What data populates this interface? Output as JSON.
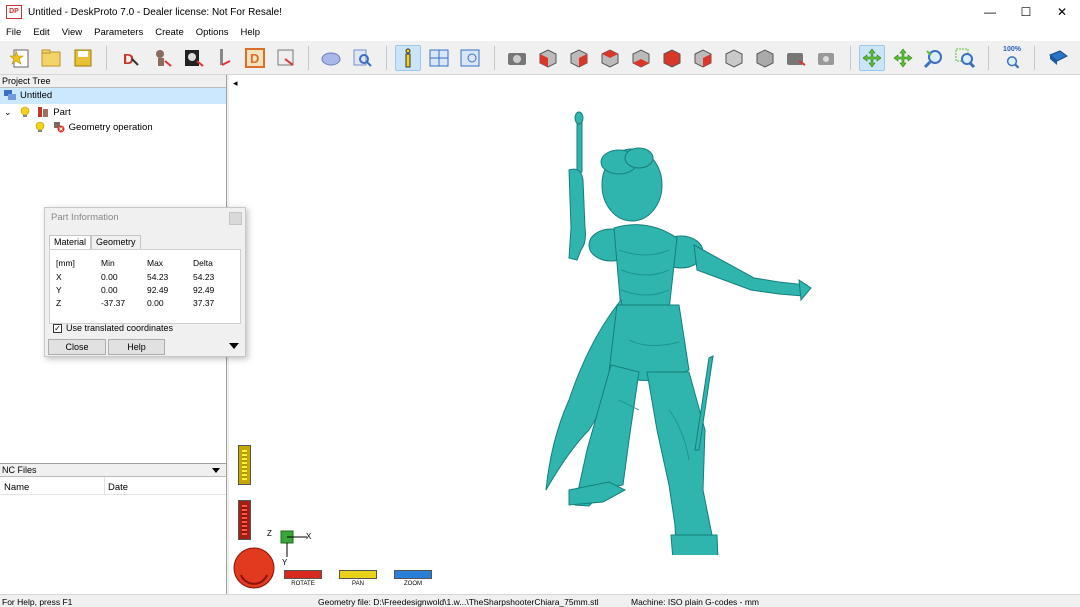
{
  "window": {
    "title": "Untitled - DeskProto 7.0 - Dealer license: Not For Resale!",
    "app_icon_text": "DP",
    "minimize": "—",
    "maximize": "☐",
    "close": "✕"
  },
  "menu": [
    "File",
    "Edit",
    "View",
    "Parameters",
    "Create",
    "Options",
    "Help"
  ],
  "toolbar": {
    "zoom_label": "100%",
    "buttons": [
      "new-icon",
      "open-icon",
      "save-icon",
      "wizard-1-icon",
      "wizard-2-icon",
      "wizard-3-icon",
      "wizard-4-icon",
      "wizard-d-icon",
      "save-nc-icon",
      "part-icon",
      "find-icon",
      "info-icon",
      "layout-icon",
      "details-icon",
      "camera-icon",
      "view-front-icon",
      "view-back-icon",
      "view-left-icon",
      "view-right-icon",
      "view-top-icon",
      "view-bottom-icon",
      "view-iso-1-icon",
      "view-iso-2-icon",
      "view-iso-3-icon",
      "snapshot-icon",
      "snapshot-2-icon",
      "rotate-icon",
      "pan-icon",
      "zoom-in-icon",
      "zoom-window-icon",
      "zoom-100-icon",
      "book-icon"
    ]
  },
  "project_tree": {
    "header": "Project Tree",
    "items": [
      {
        "label": "Untitled",
        "icon": "project-icon",
        "selected": true
      },
      {
        "label": "Part",
        "icon": "part-icon",
        "expand": "⌄"
      },
      {
        "label": "Geometry operation",
        "icon": "geometry-operation-icon"
      }
    ]
  },
  "nc_files": {
    "header": "NC Files",
    "columns": [
      "Name",
      "Date"
    ]
  },
  "part_info": {
    "title": "Part Information",
    "tabs": [
      "Material",
      "Geometry"
    ],
    "active_tab": "Material",
    "headers": [
      "[mm]",
      "Min",
      "Max",
      "Delta"
    ],
    "rows": [
      {
        "axis": "X",
        "min": "0.00",
        "max": "54.23",
        "delta": "54.23"
      },
      {
        "axis": "Y",
        "min": "0.00",
        "max": "92.49",
        "delta": "92.49"
      },
      {
        "axis": "Z",
        "min": "-37.37",
        "max": "0.00",
        "delta": "37.37"
      }
    ],
    "checkbox_label": "Use translated coordinates",
    "checkbox_checked": "✓",
    "close_label": "Close",
    "help_label": "Help"
  },
  "viewport": {
    "model_color": "#2fb5ae",
    "axes": {
      "x": "X",
      "y": "Y",
      "z": "Z"
    },
    "controls": [
      {
        "label": "ROTATE",
        "color": "#d9281e"
      },
      {
        "label": "PAN",
        "color": "#e8d31a"
      },
      {
        "label": "ZOOM",
        "color": "#2a7fd6"
      }
    ],
    "collapse_arrow": "◂"
  },
  "statusbar": {
    "help": "For Help, press F1",
    "geometry": "Geometry file: D:\\Freedesignwold\\1.w...\\TheSharpshooterChiara_75mm.stl",
    "machine": "Machine: ISO plain G-codes - mm"
  }
}
